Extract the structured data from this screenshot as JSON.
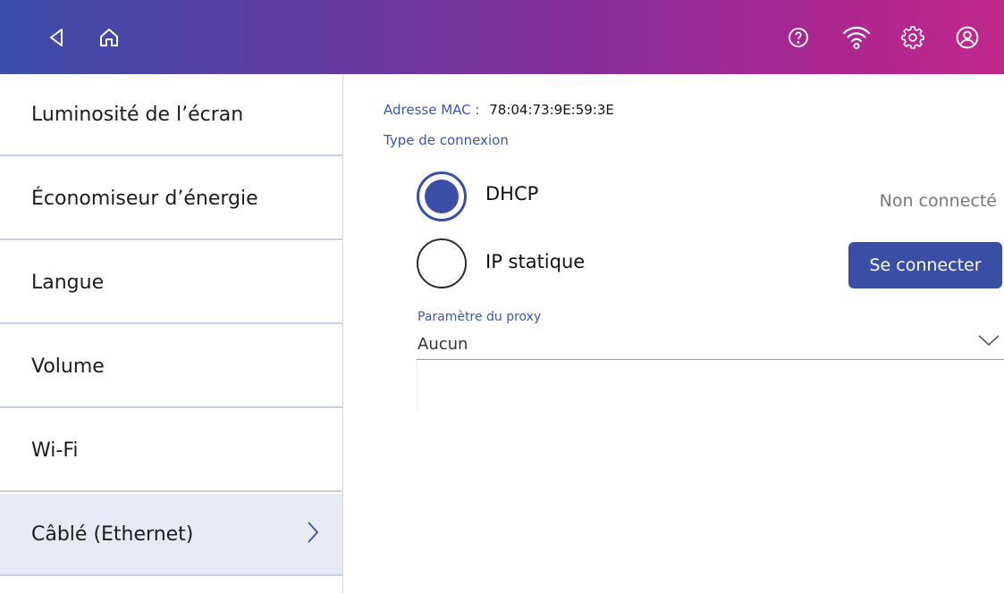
{
  "header": {
    "icons": [
      "back-icon",
      "home-icon",
      "help-icon",
      "wifi-icon",
      "settings-icon",
      "account-icon"
    ],
    "colors": {
      "gradient_start": "#3b4ea8",
      "gradient_end": "#c0288c"
    }
  },
  "sidebar": {
    "items": [
      {
        "label": "Luminosité de l’écran"
      },
      {
        "label": "Économiseur d’énergie"
      },
      {
        "label": "Langue"
      },
      {
        "label": "Volume"
      },
      {
        "label": "Wi-Fi"
      },
      {
        "label": "Câblé (Ethernet)",
        "active": true
      }
    ]
  },
  "main": {
    "mac_label": "Adresse MAC :",
    "mac_value": "78:04:73:9E:59:3E",
    "connection_type_label": "Type de connexion",
    "options": [
      {
        "label": "DHCP",
        "selected": true
      },
      {
        "label": "IP statique",
        "selected": false
      }
    ],
    "status": "Non connecté",
    "connect_button": "Se connecter",
    "proxy": {
      "label": "Paramètre du proxy",
      "value": "Aucun"
    },
    "accent_color": "#3b4ea6"
  }
}
